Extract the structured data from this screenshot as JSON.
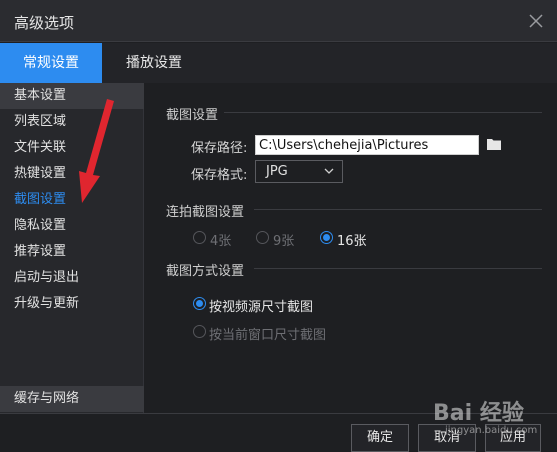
{
  "window": {
    "title": "高级选项"
  },
  "tabs": [
    {
      "label": "常规设置",
      "active": true
    },
    {
      "label": "播放设置",
      "active": false
    }
  ],
  "sidebar": {
    "items": [
      {
        "label": "基本设置"
      },
      {
        "label": "列表区域"
      },
      {
        "label": "文件关联"
      },
      {
        "label": "热键设置"
      },
      {
        "label": "截图设置",
        "active": true
      },
      {
        "label": "隐私设置"
      },
      {
        "label": "推荐设置"
      },
      {
        "label": "启动与退出"
      },
      {
        "label": "升级与更新"
      }
    ],
    "bottom_item": "缓存与网络"
  },
  "screenshot_settings": {
    "title": "截图设置",
    "path_label": "保存路径:",
    "path_value": "C:\\Users\\chehejia\\Pictures",
    "format_label": "保存格式:",
    "format_value": "JPG"
  },
  "burst": {
    "title": "连拍截图设置",
    "options": [
      "4张",
      "9张",
      "16张"
    ],
    "selected": "16张"
  },
  "mode": {
    "title": "截图方式设置",
    "options": [
      "按视频源尺寸截图",
      "按当前窗口尺寸截图"
    ],
    "selected": "按视频源尺寸截图"
  },
  "buttons": {
    "ok": "确定",
    "cancel": "取消",
    "apply": "应用"
  },
  "watermark": {
    "brand": "Bai 经验",
    "url": "jingyan.baidu.com"
  },
  "colors": {
    "accent": "#2d8cf0",
    "background": "#1e1f22",
    "annotation_arrow": "#e0262f"
  }
}
